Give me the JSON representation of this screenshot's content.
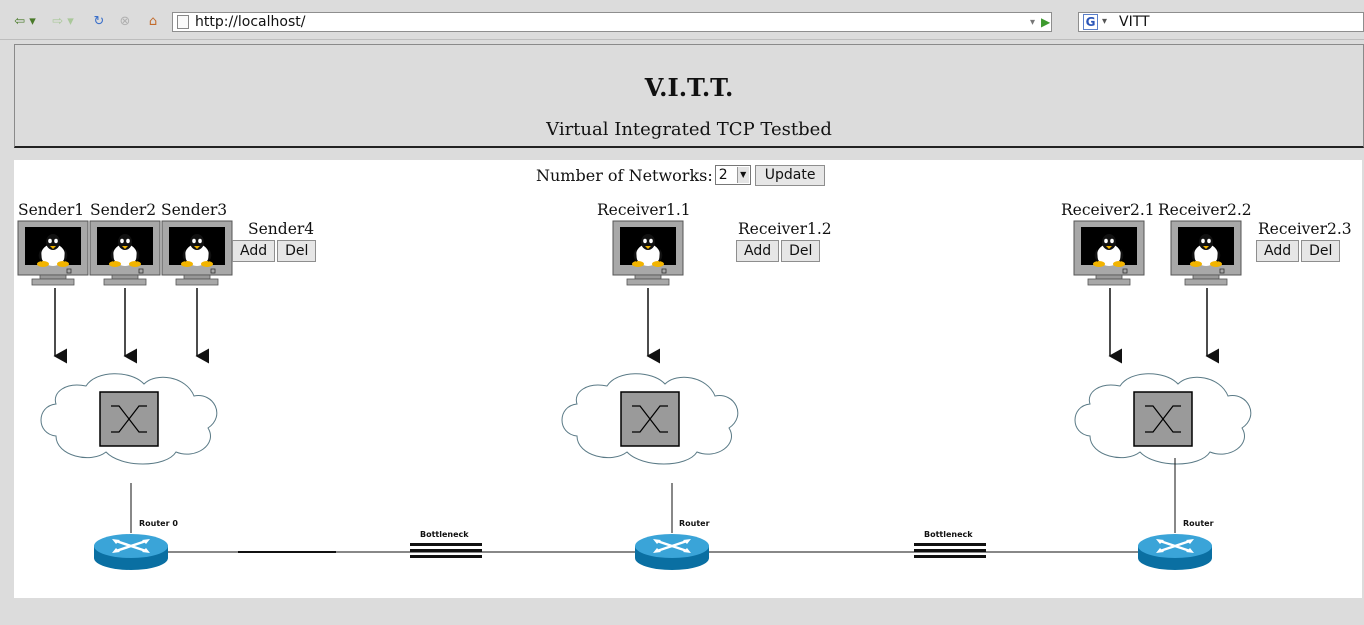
{
  "browser": {
    "url": "http://localhost/",
    "search_text": "VITT",
    "search_engine_letter": "G"
  },
  "header": {
    "title": "V.I.T.T.",
    "subtitle": "Virtual Integrated TCP Testbed"
  },
  "controls": {
    "network_count_label": "Number of Networks:",
    "network_count_value": "2",
    "update_label": "Update"
  },
  "network0": {
    "senders": [
      "Sender1",
      "Sender2",
      "Sender3"
    ],
    "next_label": "Sender4",
    "add_label": "Add",
    "del_label": "Del",
    "router_label": "Router 0"
  },
  "network1": {
    "receivers": [
      "Receiver1.1"
    ],
    "next_label": "Receiver1.2",
    "add_label": "Add",
    "del_label": "Del",
    "router_label": "Router"
  },
  "network2": {
    "receivers": [
      "Receiver2.1",
      "Receiver2.2"
    ],
    "next_label": "Receiver2.3",
    "add_label": "Add",
    "del_label": "Del",
    "router_label": "Router"
  },
  "links": {
    "bottleneck1": "Bottleneck",
    "bottleneck2": "Bottleneck"
  },
  "icons": [
    "back-icon",
    "forward-icon",
    "reload-icon",
    "stop-icon",
    "home-icon",
    "page-icon",
    "go-icon",
    "google-icon",
    "monitor-icon",
    "tux-icon",
    "switch-icon",
    "cloud-icon",
    "router-icon",
    "bottleneck-icon",
    "arrow-down-icon"
  ]
}
